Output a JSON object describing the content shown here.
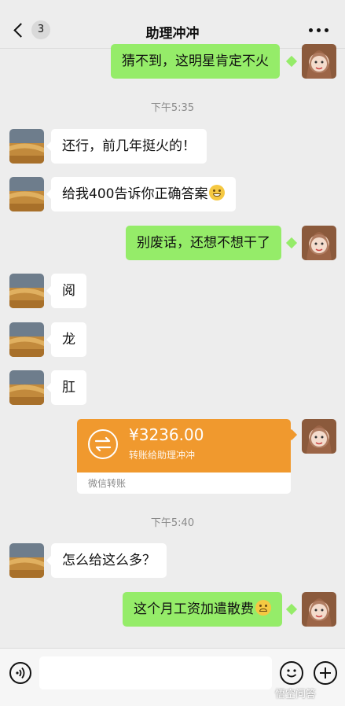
{
  "header": {
    "back_badge": "3",
    "title": "助理冲冲"
  },
  "messages": [
    {
      "side": "out",
      "text": "猜不到，这明星肯定不火"
    },
    {
      "time": "下午5:35"
    },
    {
      "side": "in",
      "text": "还行，前几年挺火的！"
    },
    {
      "side": "in",
      "text": "给我400告诉你正确答案"
    },
    {
      "side": "out",
      "text": "别废话，还想不想干了"
    },
    {
      "side": "in",
      "text": "阅"
    },
    {
      "side": "in",
      "text": "龙"
    },
    {
      "side": "in",
      "text": "肛"
    },
    {
      "side": "out",
      "transfer": true
    },
    {
      "time": "下午5:40"
    },
    {
      "side": "in",
      "text": "怎么给这么多？"
    },
    {
      "side": "out",
      "text": "这个月工资加遣散费"
    }
  ],
  "transfer": {
    "amount": "¥3236.00",
    "note": "转账给助理冲冲",
    "footer": "微信转账"
  },
  "timestamps": {
    "t1": "下午5:35",
    "t2": "下午5:40"
  },
  "texts": {
    "m1": "猜不到，这明星肯定不火",
    "m2": "还行，前几年挺火的！",
    "m3": "给我400告诉你正确答案",
    "m4": "别废话，还想不想干了",
    "m5": "阅",
    "m6": "龙",
    "m7": "肛",
    "m8": "怎么给这么多？",
    "m9": "这个月工资加遣散费"
  },
  "watermark": "悟空问答",
  "colors": {
    "background": "#ededed",
    "outgoing_bubble": "#95ec69",
    "incoming_bubble": "#ffffff",
    "transfer": "#f0992e"
  },
  "icons": {
    "back": "chevron-left-icon",
    "more": "more-dots-icon",
    "voice": "voice-icon",
    "emoji": "emoji-icon",
    "plus": "plus-icon",
    "transfer": "transfer-arrows-icon"
  }
}
